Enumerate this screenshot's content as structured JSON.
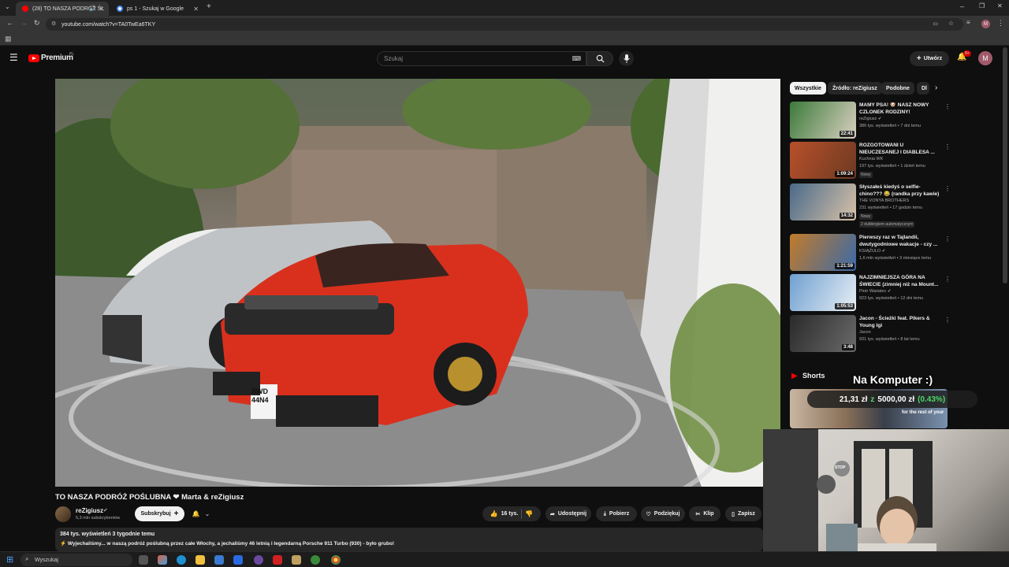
{
  "browser": {
    "tabs": [
      {
        "label": "(28) TO NASZA PODRÓŻ ŚL",
        "active": true
      },
      {
        "label": "ps 1 - Szukaj w Google",
        "active": false
      }
    ],
    "url": "youtube.com/watch?v=TA0TwEa6TKY"
  },
  "youtube": {
    "logo_text": "Premium",
    "logo_region": "PL",
    "search_placeholder": "Szukaj",
    "create_label": "Utwórz",
    "notification_count": "9+",
    "avatar_letter": "M"
  },
  "video": {
    "title": "TO NASZA PODRÓŻ POŚLUBNA ❤ Marta & reZigiusz",
    "channel": "reZigiusz",
    "subscribers": "5,3 mln subskrybentów",
    "subscribe_label": "Subskrybuj",
    "likes": "16 tys.",
    "share_label": "Udostępnij",
    "download_label": "Pobierz",
    "thanks_label": "Podziękuj",
    "clip_label": "Klip",
    "save_label": "Zapisz",
    "stats": "384 tys. wyświetleń  3 tygodnie temu",
    "description": "⚡ Wyjechaliśmy... w naszą podróż poślubną przez całe Włochy, a jechaliśmy 46 letnią i legendarną Porsche 911 Turbo (930) - było grubo!",
    "plate": "SWD 44N4"
  },
  "sidebar": {
    "chips": [
      "Wszystkie",
      "Źródło: reZigiusz",
      "Podobne",
      "Dl"
    ],
    "recommendations": [
      {
        "title": "MAMY PSA! 🐶 NASZ NOWY CZLONEK RODZINY!",
        "channel": "reZigiusz",
        "verified": true,
        "meta": "386 tys. wyświetleń • 7 dni temu",
        "duration": "22:41",
        "badges": [],
        "thumb_colors": [
          "#3c7a3a",
          "#d9d0c0"
        ]
      },
      {
        "title": "ROZGOTOWANI U NIEUCZESANEJ I DIABLESA ...",
        "channel": "Kuchnia WK",
        "verified": false,
        "meta": "197 tys. wyświetleń • 1 dzień temu",
        "duration": "1:09:24",
        "badges": [
          "Nowy"
        ],
        "thumb_colors": [
          "#b8502a",
          "#6d3a22"
        ]
      },
      {
        "title": "Słyszałeś kiedyś o selfie-chino??? 😂 (randka przy kawie)",
        "channel": "THE VONYA BROTHERS",
        "verified": false,
        "meta": "231 wyświetleń • 17 godzin temu",
        "duration": "14:32",
        "badges": [
          "Nowy",
          "2 dubbingiem automatycznym"
        ],
        "thumb_colors": [
          "#4a6a8a",
          "#d8c2a8"
        ]
      },
      {
        "title": "Pierwszy raz w Tajlandii, dwutygodniowe wakacje - czy ...",
        "channel": "KSIĄŻULO",
        "verified": true,
        "meta": "1,6 mln wyświetleń • 3 miesiące temu",
        "duration": "1:21:59",
        "badges": [],
        "thumb_colors": [
          "#c27b2a",
          "#3a6aa8"
        ]
      },
      {
        "title": "NAJZIMNIEJSZA GÓRA NA ŚWIECIE (zimniej niż na Mount...",
        "channel": "Piotr Wariatec",
        "verified": true,
        "meta": "923 tys. wyświetleń • 12 dni temu",
        "duration": "1:05:53",
        "badges": [],
        "thumb_colors": [
          "#6fa0d0",
          "#e8eef5"
        ]
      },
      {
        "title": "Jacon - Ścieżki feat. Pikers & Young Igi",
        "channel": "Jacon",
        "verified": false,
        "meta": "931 tys. wyświetleń • 8 lat temu",
        "duration": "3:48",
        "badges": [],
        "thumb_colors": [
          "#2a2a2a",
          "#6a6a6a"
        ]
      }
    ],
    "shorts_label": "Shorts",
    "shorts_caption": "for the rest of your"
  },
  "overlay": {
    "title": "Na Komputer :)",
    "amount": "21,31 zł",
    "of": "z",
    "goal": "5000,00 zł",
    "percent": "(0.43%)"
  },
  "webcam": {
    "sign_text": "STOP"
  },
  "taskbar": {
    "search_placeholder": "Wyszukaj"
  }
}
